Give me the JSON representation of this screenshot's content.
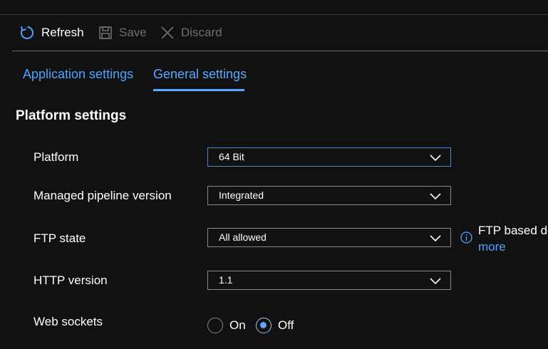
{
  "toolbar": {
    "refresh_label": "Refresh",
    "save_label": "Save",
    "discard_label": "Discard"
  },
  "tabs": [
    {
      "label": "Application settings",
      "selected": false
    },
    {
      "label": "General settings",
      "selected": true
    }
  ],
  "section_title": "Platform settings",
  "fields": {
    "platform": {
      "label": "Platform",
      "value": "64 Bit"
    },
    "pipeline": {
      "label": "Managed pipeline version",
      "value": "Integrated"
    },
    "ftp": {
      "label": "FTP state",
      "value": "All allowed",
      "info_text": "FTP based de",
      "info_link": "more"
    },
    "http": {
      "label": "HTTP version",
      "value": "1.1"
    },
    "websockets": {
      "label": "Web sockets",
      "options": [
        "On",
        "Off"
      ],
      "selected": "Off"
    }
  },
  "colors": {
    "background": "#111111",
    "accent": "#5ca9ff",
    "link": "#4da3ff",
    "disabled_text": "#6e6e6e"
  }
}
